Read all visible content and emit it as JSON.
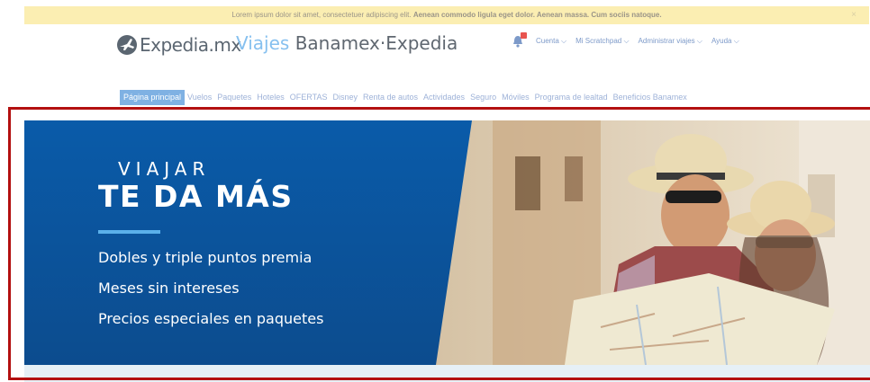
{
  "notice": {
    "text": "Lorem ipsum dolor sit amet, consectetuer adipiscing elit.",
    "text_bold": "Aenean commodo ligula eget dolor. Aenean massa. Cum sociis natoque.",
    "close_label": "×"
  },
  "header": {
    "logo_text": "Expedia.mx",
    "brand_viajes": "Viajes",
    "brand_banamex": "Banamex",
    "brand_dot": "·",
    "brand_expedia": "Expedia"
  },
  "topnav": {
    "items": [
      {
        "label": "Cuenta"
      },
      {
        "label": "Mi Scratchpad"
      },
      {
        "label": "Administrar viajes"
      },
      {
        "label": "Ayuda"
      }
    ]
  },
  "mainnav": {
    "items": [
      {
        "label": "Página principal",
        "active": true
      },
      {
        "label": "Vuelos"
      },
      {
        "label": "Paquetes"
      },
      {
        "label": "Hoteles"
      },
      {
        "label": "OFERTAS"
      },
      {
        "label": "Disney"
      },
      {
        "label": "Renta de autos"
      },
      {
        "label": "Actividades"
      },
      {
        "label": "Seguro"
      },
      {
        "label": "Móviles"
      },
      {
        "label": "Programa de lealtad"
      },
      {
        "label": "Beneficios Banamex"
      }
    ]
  },
  "hero": {
    "line1": "VIAJAR",
    "line2": "TE DA MÁS",
    "bullets": [
      "Dobles y triple puntos premia",
      "Meses sin intereses",
      "Precios especiales en paquetes"
    ]
  },
  "colors": {
    "accent_blue": "#0a5aa8",
    "rule_blue": "#5ab0ea",
    "frame_red": "#b31010",
    "notice_bg": "#fbeeb2"
  },
  "icons": {
    "bell": "bell-icon",
    "logo": "globe-plane-icon"
  }
}
